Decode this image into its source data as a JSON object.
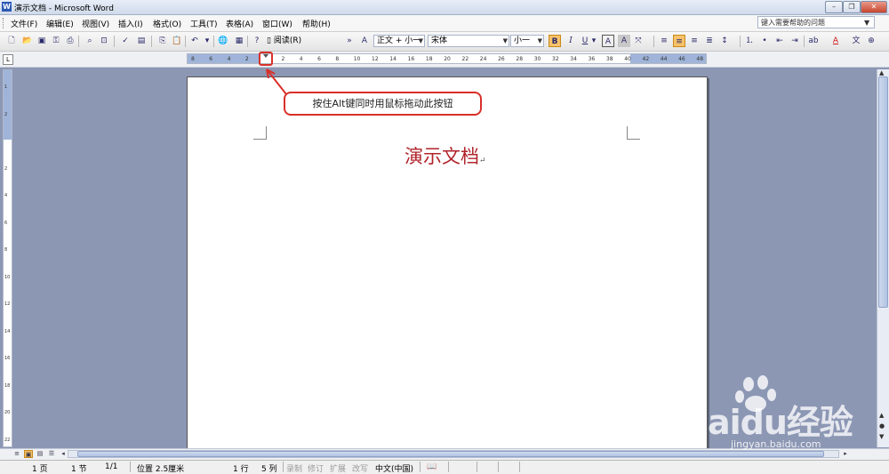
{
  "window": {
    "title": "演示文档 - Microsoft Word",
    "help_placeholder": "键入需要帮助的问题",
    "min_icon": "minimize-icon",
    "max_icon": "restore-icon",
    "close_icon": "close-icon"
  },
  "menu": {
    "items": [
      "文件(F)",
      "编辑(E)",
      "视图(V)",
      "插入(I)",
      "格式(O)",
      "工具(T)",
      "表格(A)",
      "窗口(W)",
      "帮助(H)"
    ]
  },
  "toolbar": {
    "read_label": "阅读(R)",
    "style_value": "正文 + 小一",
    "font_value": "宋体",
    "size_value": "小一",
    "bold_label": "B",
    "italic_label": "I",
    "underline_label": "U",
    "font_color_label": "A",
    "highlight_label": "A"
  },
  "ruler": {
    "horizontal_ticks": [
      "8",
      "6",
      "4",
      "2",
      "",
      "2",
      "4",
      "6",
      "8",
      "10",
      "12",
      "14",
      "16",
      "18",
      "20",
      "22",
      "24",
      "26",
      "28",
      "30",
      "32",
      "34",
      "36",
      "38",
      "40",
      "42",
      "44",
      "46",
      "48"
    ],
    "vertical_ticks": [
      "1",
      "2",
      "",
      "2",
      "4",
      "6",
      "8",
      "10",
      "12",
      "14",
      "16",
      "18",
      "20",
      "22"
    ]
  },
  "document": {
    "heading": "演示文档",
    "para_mark": "↵"
  },
  "annotation": {
    "callout_text": "按住Alt键同时用鼠标拖动此按钮"
  },
  "status": {
    "page": "1 页",
    "section": "1 节",
    "page_count": "1/1",
    "position": "位置 2.5厘米",
    "line": "1 行",
    "column": "5 列",
    "rec": "录制",
    "trk": "修订",
    "ext": "扩展",
    "ovr": "改写",
    "language": "中文(中国)"
  },
  "watermark": {
    "brand": "Baidu经验",
    "url": "jingyan.baidu.com"
  },
  "colors": {
    "heading": "#b0232a",
    "annotation": "#d9302a",
    "workspace": "#8c97b4"
  }
}
